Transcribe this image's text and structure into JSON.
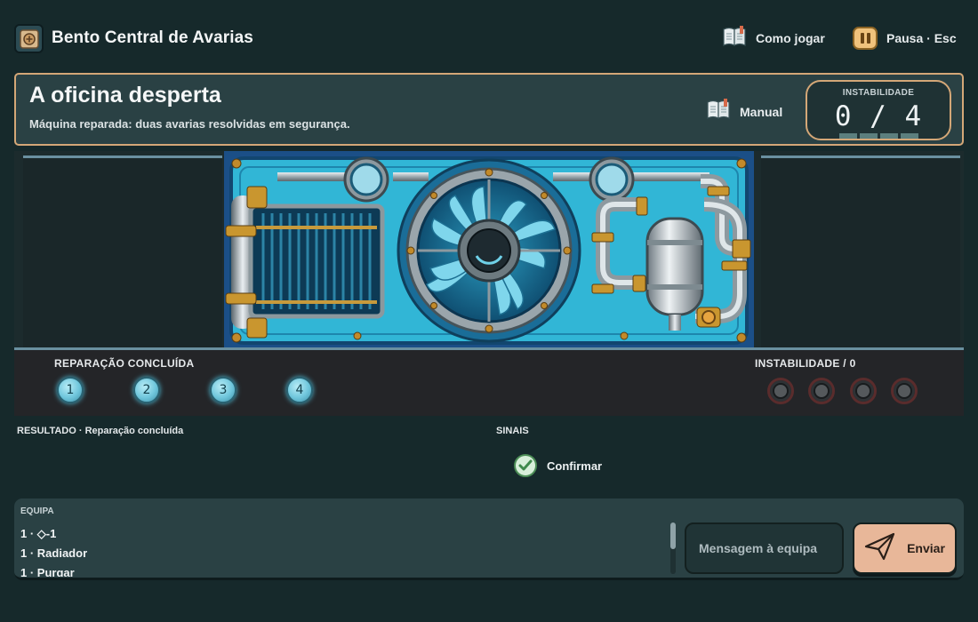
{
  "app": {
    "title": "Bento Central de Avarias",
    "logo_icon": "gear-badge-icon"
  },
  "topbar": {
    "howto": {
      "label": "Como jogar",
      "icon": "open-book-icon"
    },
    "pause": {
      "label": "Pausa · Esc",
      "icon": "pause-icon",
      "color": "#f0c27c"
    }
  },
  "header": {
    "title": "A oficina desperta",
    "subtitle": "Máquina reparada: duas avarias resolvidas em segurança.",
    "manual": {
      "label": "Manual",
      "icon": "open-book-icon"
    },
    "instability": {
      "label": "INSTABILIDADE",
      "value": "0 / 4"
    }
  },
  "status": {
    "repair_label": "REPARAÇÃO CONCLUÍDA",
    "steps": [
      "1",
      "2",
      "3",
      "4"
    ],
    "instability_label": "INSTABILIDADE / 0",
    "instability_leds": 4,
    "instability_value": 0
  },
  "result": {
    "text": "RESULTADO · Reparação concluída"
  },
  "signals": {
    "label": "SINAIS",
    "confirm_label": "Confirmar",
    "confirm_icon": "check-circle-icon"
  },
  "team": {
    "label": "EQUIPA",
    "log": [
      "1 · ◇-1",
      "1 · Radiador",
      "1 · Purgar"
    ],
    "input_placeholder": "Mensagem à equipa",
    "send_label": "Enviar",
    "send_icon": "paper-plane-icon"
  },
  "colors": {
    "background": "#16292b",
    "accent_border": "#d4a777",
    "panel": "#2a4144",
    "send_button": "#e8b799",
    "machine_blue": "#2fb3d2",
    "step_cyan": "#6fc6dc"
  }
}
